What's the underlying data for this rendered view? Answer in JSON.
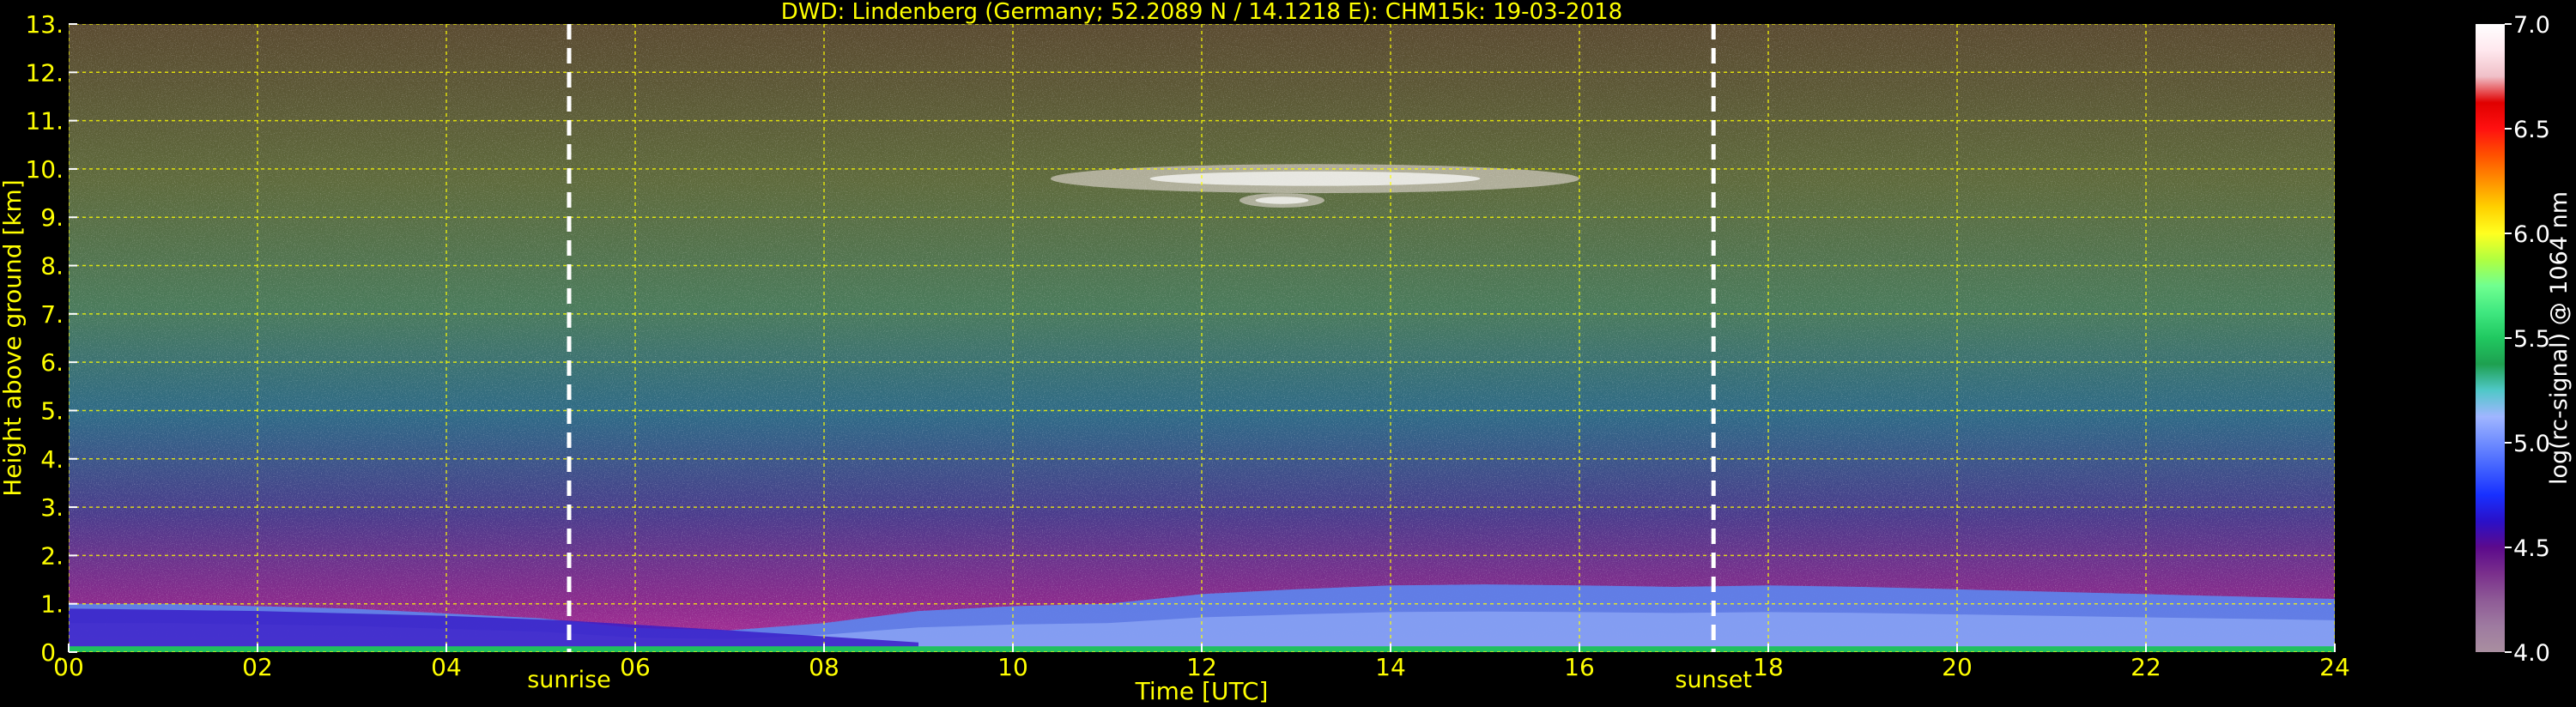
{
  "chart_data": {
    "type": "heatmap",
    "title": "DWD: Lindenberg (Germany; 52.2089 N / 14.1218 E):    CHM15k: 19-03-2018",
    "xlabel": "Time [UTC]",
    "ylabel": "Height above ground [km]",
    "xlim": [
      0,
      24
    ],
    "ylim": [
      0,
      13
    ],
    "x_ticks": [
      0,
      2,
      4,
      6,
      8,
      10,
      12,
      14,
      16,
      18,
      20,
      22,
      24
    ],
    "x_tick_labels": [
      "00",
      "02",
      "04",
      "06",
      "08",
      "10",
      "12",
      "14",
      "16",
      "18",
      "20",
      "22",
      "24"
    ],
    "y_ticks": [
      0,
      1,
      2,
      3,
      4,
      5,
      6,
      7,
      8,
      9,
      10,
      11,
      12,
      13
    ],
    "y_tick_labels": [
      "0.",
      "1.",
      "2.",
      "3.",
      "4.",
      "5.",
      "6.",
      "7.",
      "8.",
      "9.",
      "10.",
      "11.",
      "12.",
      "13."
    ],
    "grid": true,
    "colorbar": {
      "label": "log(rc-signal) @ 1064 nm",
      "range": [
        4.0,
        7.0
      ],
      "ticks": [
        4.0,
        4.5,
        5.0,
        5.5,
        6.0,
        6.5,
        7.0
      ],
      "tick_labels": [
        "4.0",
        "4.5",
        "5.0",
        "5.5",
        "6.0",
        "6.5",
        "7.0"
      ],
      "colors": [
        "#a98fa0",
        "#9e7aa0",
        "#8e5a96",
        "#7a2f8c",
        "#5c0a8c",
        "#2a10c8",
        "#1830ff",
        "#4060ff",
        "#6f8cff",
        "#a0b6ff",
        "#50c8c8",
        "#1ea050",
        "#20c860",
        "#40e880",
        "#70ff90",
        "#b0ff40",
        "#ffff20",
        "#ffd000",
        "#ff9000",
        "#ff5000",
        "#ff1010",
        "#e00000",
        "#f0c0c8",
        "#ffe8ee",
        "#ffffff"
      ]
    },
    "annotations": [
      {
        "label": "sunrise",
        "x": 5.3
      },
      {
        "label": "sunset",
        "x": 17.42
      }
    ],
    "boundary_layer": {
      "time": [
        0,
        1,
        2,
        3,
        4,
        5,
        6,
        7,
        8,
        9,
        10,
        11,
        12,
        13,
        14,
        15,
        16,
        17,
        18,
        19,
        20,
        21,
        22,
        23,
        24
      ],
      "top_km": [
        1.0,
        1.0,
        0.95,
        0.9,
        0.8,
        0.7,
        0.5,
        0.45,
        0.6,
        0.85,
        0.95,
        1.0,
        1.2,
        1.3,
        1.38,
        1.4,
        1.38,
        1.35,
        1.38,
        1.35,
        1.3,
        1.25,
        1.2,
        1.15,
        1.1
      ]
    },
    "cloud_layers": [
      {
        "x_start": 10.4,
        "x_end": 16.0,
        "base_km": 9.5,
        "top_km": 10.1
      },
      {
        "x_start": 12.4,
        "x_end": 13.3,
        "base_km": 9.2,
        "top_km": 9.5
      }
    ]
  }
}
